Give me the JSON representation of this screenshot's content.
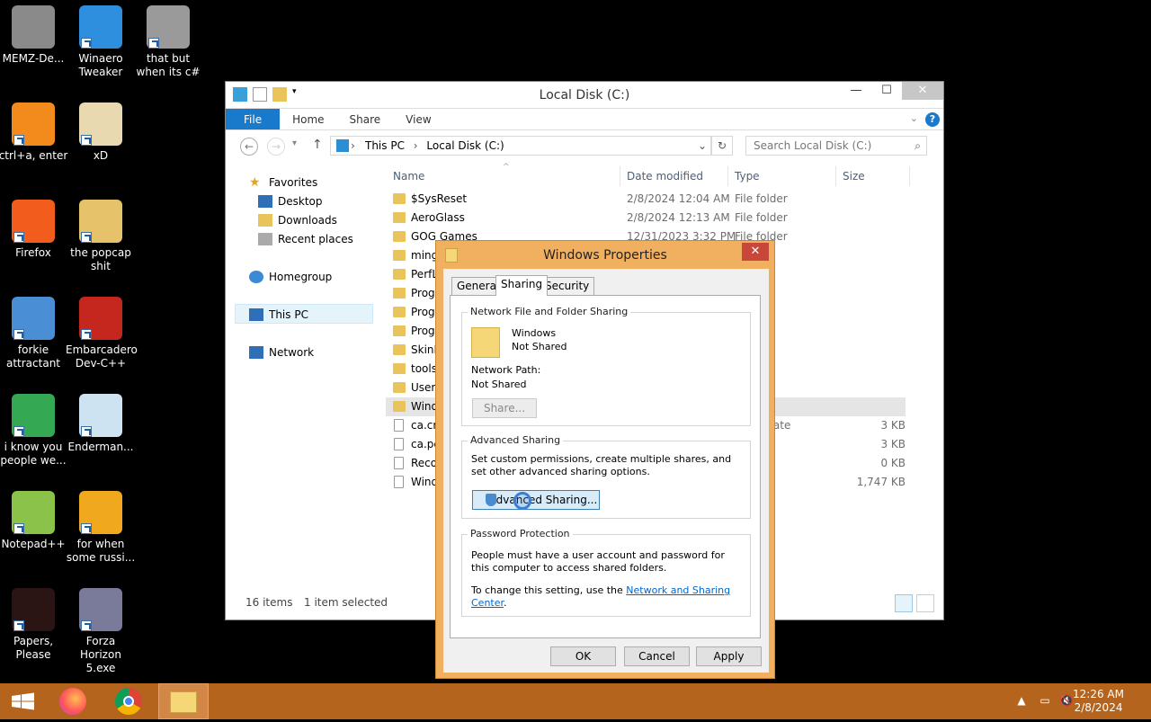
{
  "desktop_icons": [
    {
      "label": "MEMZ-De...",
      "icon": "recycle-bin-icon",
      "color": "#8a8a8a"
    },
    {
      "label": "Winaero Tweaker",
      "icon": "winaero-icon",
      "color": "#2f8fdf"
    },
    {
      "label": "that but when its c#",
      "icon": "windows-stack-icon",
      "color": "#9a9a9a"
    },
    {
      "label": "ctrl+a, enter",
      "icon": "ring-icon",
      "color": "#f28a1c"
    },
    {
      "label": "xD",
      "icon": "hxd-icon",
      "color": "#e8d9b0"
    },
    {
      "label": "Firefox",
      "icon": "firefox-icon",
      "color": "#f25c1c"
    },
    {
      "label": "the popcap shit",
      "icon": "folder-icon",
      "color": "#e6c36a"
    },
    {
      "label": "forkie attractant",
      "icon": "remote-desktop-icon",
      "color": "#4a8ed6"
    },
    {
      "label": "Embarcadero Dev-C++",
      "icon": "devcpp-icon",
      "color": "#c5261d"
    },
    {
      "label": "i know you people we...",
      "icon": "chrome-icon",
      "color": "#34a853"
    },
    {
      "label": "Enderman...",
      "icon": "window-app-icon",
      "color": "#cde3f2"
    },
    {
      "label": "Notepad++",
      "icon": "notepadpp-icon",
      "color": "#8bc34a"
    },
    {
      "label": "for when some russi...",
      "icon": "de-icon",
      "color": "#f0a91e"
    },
    {
      "label": "Papers, Please",
      "icon": "papers-please-icon",
      "color": "#2a1414"
    },
    {
      "label": "Forza Horizon 5.exe",
      "icon": "flash-icon",
      "color": "#7a7a9a"
    }
  ],
  "explorer": {
    "title": "Local Disk (C:)",
    "ribbon": {
      "file": "File",
      "home": "Home",
      "share": "Share",
      "view": "View",
      "help": "?"
    },
    "breadcrumb": {
      "root": "This PC",
      "sep": "›",
      "current": "Local Disk (C:)"
    },
    "search_placeholder": "Search Local Disk (C:)",
    "nav": {
      "favorites": "Favorites",
      "desktop": "Desktop",
      "downloads": "Downloads",
      "recent": "Recent places",
      "homegroup": "Homegroup",
      "thispc": "This PC",
      "network": "Network"
    },
    "columns": {
      "name": "Name",
      "date": "Date modified",
      "type": "Type",
      "size": "Size"
    },
    "files": [
      {
        "name": "$SysReset",
        "date": "2/8/2024 12:04 AM",
        "type": "File folder",
        "size": "",
        "kind": "folder"
      },
      {
        "name": "AeroGlass",
        "date": "2/8/2024 12:13 AM",
        "type": "File folder",
        "size": "",
        "kind": "folder"
      },
      {
        "name": "GOG Games",
        "date": "12/31/2023 3:32 PM",
        "type": "File folder",
        "size": "",
        "kind": "folder"
      },
      {
        "name": "ming",
        "date": "",
        "type": "er",
        "size": "",
        "kind": "folder"
      },
      {
        "name": "PerfL",
        "date": "",
        "type": "er",
        "size": "",
        "kind": "folder"
      },
      {
        "name": "Progr",
        "date": "",
        "type": "er",
        "size": "",
        "kind": "folder"
      },
      {
        "name": "Progr",
        "date": "",
        "type": "er",
        "size": "",
        "kind": "folder"
      },
      {
        "name": "Progr",
        "date": "",
        "type": "er",
        "size": "",
        "kind": "folder"
      },
      {
        "name": "SkinP",
        "date": "",
        "type": "er",
        "size": "",
        "kind": "folder"
      },
      {
        "name": "tools",
        "date": "",
        "type": "er",
        "size": "",
        "kind": "folder"
      },
      {
        "name": "Users",
        "date": "",
        "type": "er",
        "size": "",
        "kind": "folder"
      },
      {
        "name": "Wind",
        "date": "",
        "type": "er",
        "size": "",
        "kind": "folder",
        "selected": true
      },
      {
        "name": "ca.crt",
        "date": "",
        "type": "Certificate",
        "size": "3 KB",
        "kind": "doc"
      },
      {
        "name": "ca.pe",
        "date": "",
        "type": "",
        "size": "3 KB",
        "kind": "doc"
      },
      {
        "name": "Recov",
        "date": "",
        "type": "",
        "size": "0 KB",
        "kind": "doc"
      },
      {
        "name": "Wind",
        "date": "",
        "type": "",
        "size": "1,747 KB",
        "kind": "doc"
      }
    ],
    "status": {
      "count": "16 items",
      "selected": "1 item selected"
    }
  },
  "dialog": {
    "title": "Windows Properties",
    "close": "✕",
    "tabs": {
      "general": "General",
      "sharing": "Sharing",
      "security": "Security"
    },
    "nffs": {
      "legend": "Network File and Folder Sharing",
      "folder_name": "Windows",
      "folder_state": "Not Shared",
      "path_label": "Network Path:",
      "path_value": "Not Shared",
      "share_button": "Share..."
    },
    "advanced": {
      "legend": "Advanced Sharing",
      "desc": "Set custom permissions, create multiple shares, and set other advanced sharing options.",
      "button": "Advanced Sharing..."
    },
    "password": {
      "legend": "Password Protection",
      "desc": "People must have a user account and password for this computer to access shared folders.",
      "change_prefix": "To change this setting, use the ",
      "link": "Network and Sharing Center",
      "change_suffix": "."
    },
    "buttons": {
      "ok": "OK",
      "cancel": "Cancel",
      "apply": "Apply"
    }
  },
  "taskbar": {
    "time": "12:26 AM",
    "date": "2/8/2024",
    "accent": "#b5641e"
  }
}
